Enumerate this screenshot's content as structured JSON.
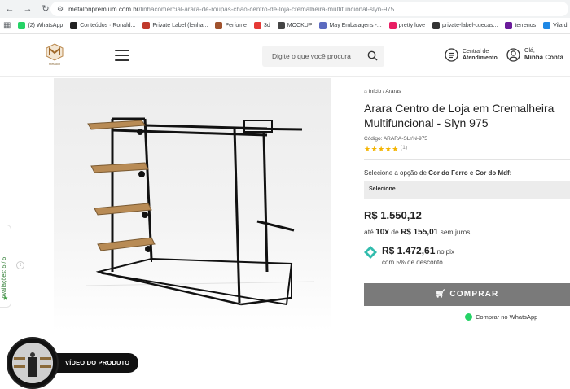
{
  "browser": {
    "url_host": "metalonpremium.com.br",
    "url_path": "/linhacomercial-arara-de-roupas-chao-centro-de-loja-cremalheira-multifuncional-slyn-975",
    "bookmarks": [
      {
        "label": "(2) WhatsApp",
        "color": "#25d366"
      },
      {
        "label": "Conteúdos · Ronald...",
        "color": "#222222"
      },
      {
        "label": "Private Label (lenha...",
        "color": "#c0392b"
      },
      {
        "label": "Perfume",
        "color": "#a0522d"
      },
      {
        "label": "3d",
        "color": "#e53935"
      },
      {
        "label": "MOCKUP",
        "color": "#444444"
      },
      {
        "label": "May Embalagens -...",
        "color": "#5c6bc0"
      },
      {
        "label": "pretty love",
        "color": "#e91e63"
      },
      {
        "label": "private-label-cuecas...",
        "color": "#333333"
      },
      {
        "label": "terrenos",
        "color": "#6a1b9a"
      },
      {
        "label": "Vila di F",
        "color": "#1e88e5"
      }
    ]
  },
  "header": {
    "logo_text": "metalon",
    "search_placeholder": "Digite o que você procura",
    "attend_line1": "Central de",
    "attend_line2": "Atendimento",
    "account_line1": "Olá,",
    "account_line2": "Minha Conta"
  },
  "gallery": {
    "reviews_label": "Avaliações: 5 / 5",
    "video_label": "VÍDEO DO PRODUTO"
  },
  "product": {
    "breadcrumb_home": "Início",
    "breadcrumb_sep": "/",
    "breadcrumb_cat": "Araras",
    "title": "Arara Centro de Loja em Cremalheira Multifuncional - Slyn 975",
    "code": "Código: ARARA-SLYN-975",
    "rating_stars": "★★★★★",
    "rating_count": "(1)",
    "option_prefix": "Selecione a opção de ",
    "option_bold": "Cor do Ferro e Cor do Mdf:",
    "select_value": "Selecione",
    "price": "R$ 1.550,12",
    "install_pre": "até ",
    "install_n": "10x",
    "install_mid": " de ",
    "install_value": "R$ 155,01",
    "install_post": " sem juros",
    "pix_price": "R$ 1.472,61",
    "pix_suffix": " no pix",
    "pix_discount": "com 5% de desconto",
    "buy_label": "COMPRAR",
    "whatsapp_label": "Comprar no WhatsApp"
  }
}
